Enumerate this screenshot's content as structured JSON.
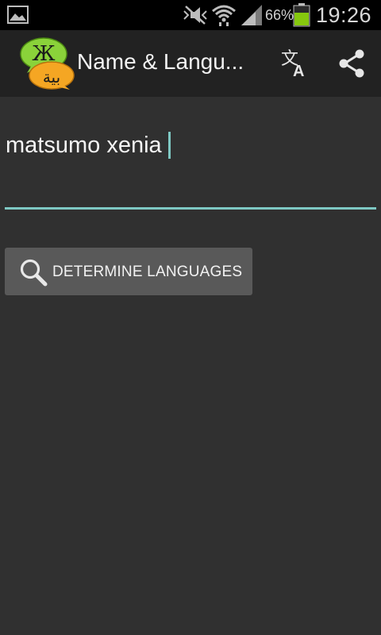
{
  "status_bar": {
    "battery_percent": "66%",
    "time": "19:26",
    "battery_level": 0.66,
    "icons": [
      "gallery-icon",
      "mute-icon",
      "wifi-icon",
      "signal-icon",
      "battery-icon"
    ]
  },
  "action_bar": {
    "title": "Name & Langu...",
    "logo_letters": {
      "top": "Ж",
      "bottom": "بية"
    },
    "actions": [
      "translate-icon",
      "share-icon"
    ]
  },
  "name_input": {
    "value": "matsumo xenia"
  },
  "determine_button": {
    "label": "DETERMINE LANGUAGES",
    "icon": "search-icon"
  },
  "colors": {
    "background": "#303030",
    "action_bar": "#222222",
    "accent": "#7ec8c3",
    "button": "#595959",
    "logo_green": "#8ad23a",
    "logo_orange": "#f5a623",
    "battery_green": "#86c80e"
  }
}
